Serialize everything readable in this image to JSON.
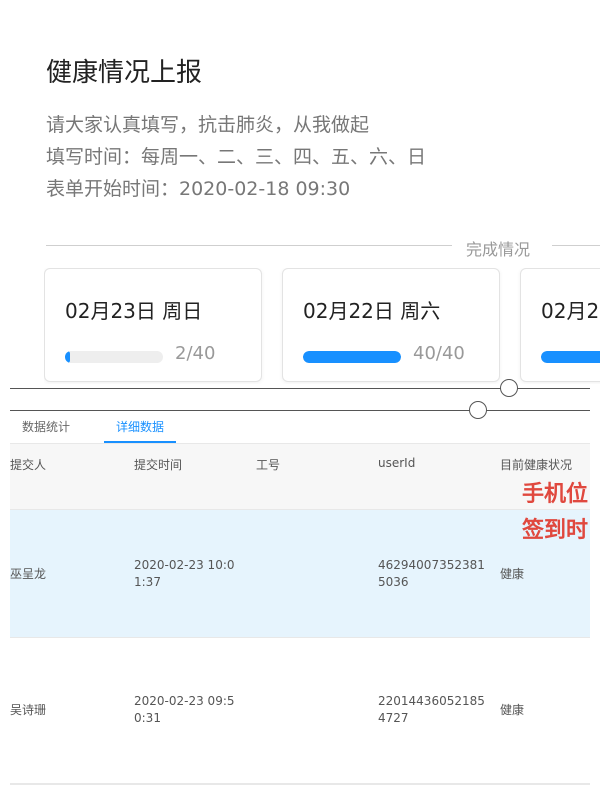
{
  "header": {
    "title": "健康情况上报",
    "line1": "请大家认真填写，抗击肺炎，从我做起",
    "line2": "填写时间：每周一、二、三、四、五、六、日",
    "line3": "表单开始时间：2020-02-18 09:30"
  },
  "divider_label": "完成情况",
  "cards": [
    {
      "date": "02月23日 周日",
      "count": "2/40",
      "progress": 0.05
    },
    {
      "date": "02月22日 周六",
      "count": "40/40",
      "progress": 1.0
    },
    {
      "date": "02月2",
      "count": "",
      "progress": 1.0
    }
  ],
  "tabs": [
    {
      "label": "数据统计"
    },
    {
      "label": "详细数据"
    }
  ],
  "table": {
    "columns": [
      "提交人",
      "提交时间",
      "工号",
      "userId",
      "目前健康状况"
    ],
    "rows": [
      {
        "name": "巫呈龙",
        "time_a": "2020-02-23 10:0",
        "time_b": "1:37",
        "id": "",
        "uid_a": "46294007352381",
        "uid_b": "5036",
        "health": "健康"
      },
      {
        "name": "吴诗珊",
        "time_a": "2020-02-23 09:5",
        "time_b": "0:31",
        "id": "",
        "uid_a": "22014436052185",
        "uid_b": "4727",
        "health": "健康"
      }
    ]
  },
  "overlay": {
    "line1": "手机位",
    "line2": "签到时"
  },
  "colors": {
    "accent": "#1890ff",
    "overlay_red": "#e0483e",
    "selected_row": "#e6f4fd"
  }
}
